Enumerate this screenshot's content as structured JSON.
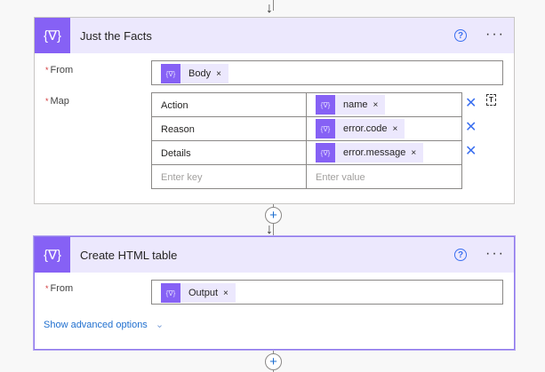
{
  "cards": [
    {
      "title": "Just the Facts",
      "help": "?",
      "more": "···",
      "from_label": "From",
      "from_token": "Body",
      "map_label": "Map",
      "map_rows": [
        {
          "key": "Action",
          "value": "name"
        },
        {
          "key": "Reason",
          "value": "error.code"
        },
        {
          "key": "Details",
          "value": "error.message"
        }
      ],
      "key_placeholder": "Enter key",
      "value_placeholder": "Enter value"
    },
    {
      "title": "Create HTML table",
      "help": "?",
      "more": "···",
      "from_label": "From",
      "from_token": "Output",
      "advanced": "Show advanced options"
    }
  ],
  "icons": {
    "action": "{∇}",
    "close": "×",
    "delete": "✕",
    "plus": "+",
    "arrow": "↓",
    "chevron": "⌄"
  }
}
